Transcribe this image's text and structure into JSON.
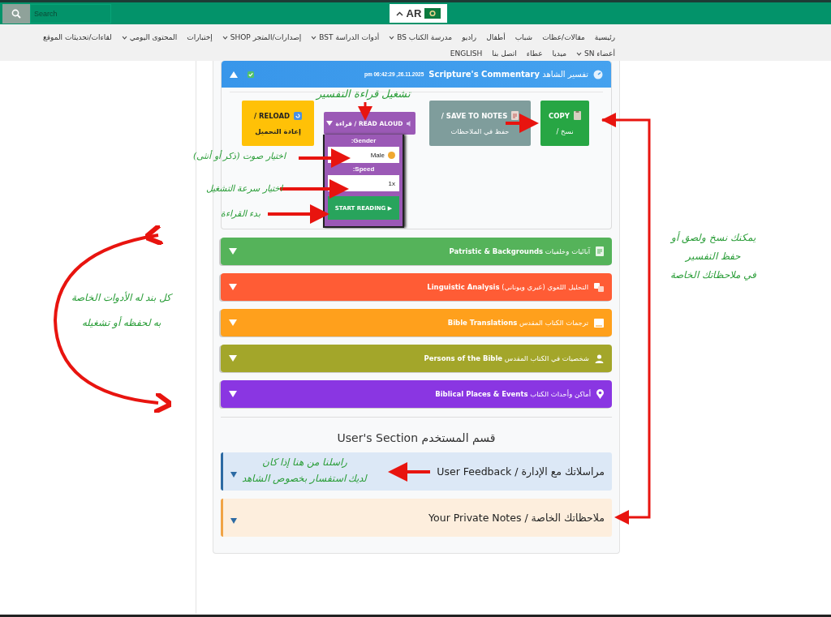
{
  "search": {
    "placeholder": "Search"
  },
  "language": {
    "code": "AR",
    "expanded": true
  },
  "nav": {
    "rows": [
      [
        {
          "label": "رئيسية",
          "dropdown": false
        },
        {
          "label": "مقالات/عظات",
          "dropdown": false
        },
        {
          "label": "شباب",
          "dropdown": false
        },
        {
          "label": "أطفال",
          "dropdown": false
        },
        {
          "label": "راديو",
          "dropdown": false
        },
        {
          "label": "مدرسة الكتاب BS",
          "dropdown": true
        },
        {
          "label": "أدوات الدراسة BST",
          "dropdown": true
        },
        {
          "label": "إصدارات/المتجر SHOP",
          "dropdown": true
        },
        {
          "label": "إختبارات",
          "dropdown": false
        },
        {
          "label": "المحتوى اليومي",
          "dropdown": true
        },
        {
          "label": "لقاءات/تحديثات الموقع",
          "dropdown": false
        }
      ],
      [
        {
          "label": "أعضاء SN",
          "dropdown": true
        },
        {
          "label": "ميديا",
          "dropdown": false
        },
        {
          "label": "عطاء",
          "dropdown": false
        },
        {
          "label": "اتصل بنا",
          "dropdown": false
        },
        {
          "label": "ENGLISH",
          "dropdown": false
        }
      ]
    ]
  },
  "commentary": {
    "title": "تفسير الشاهد **Scripture's Commentary**",
    "timestamp": "pm 06:42:29 ,26.11.2025",
    "expanded": true,
    "buttons": [
      {
        "kind": "copy",
        "label": "COPY",
        "sub": "/ نسخ"
      },
      {
        "kind": "save",
        "label": "/ SAVE TO NOTES",
        "sub": "حفظ في الملاحظات"
      },
      {
        "kind": "read",
        "label": "قراءة / READ ALOUD",
        "expanded": true
      },
      {
        "kind": "reload",
        "label": "/ RELOAD",
        "sub": "إعادة التحميل"
      }
    ],
    "reader": {
      "gender_label": ":Gender",
      "gender": "Male",
      "speed_label": ":Speed",
      "speed": "1x",
      "start": "START READING ▶"
    }
  },
  "sections": [
    {
      "kind": "document",
      "label": "آبائيات وخلفيات **Patristic & Backgrounds**",
      "color": "#55b35a",
      "expanded": false
    },
    {
      "kind": "translate",
      "label": "التحليل اللغوي (عبري ويوناني) **Linguistic Analysis**",
      "color": "#ff5c35",
      "expanded": false
    },
    {
      "kind": "book",
      "label": "ترجمات الكتاب المقدس **Bible Translations**",
      "color": "#ffa01c",
      "expanded": false
    },
    {
      "kind": "person",
      "label": "شخصيات في الكتاب المقدس **Persons of the Bible**",
      "color": "#a3a62a",
      "expanded": false
    },
    {
      "kind": "pin",
      "label": "أماكن وأحداث الكتاب **Biblical Places & Events**",
      "color": "#8a36e2",
      "expanded": false
    }
  ],
  "user_section": {
    "heading": "User's Section قسم المستخدم",
    "panels": [
      {
        "label": "User Feedback / مراسلاتك مع الإدارة",
        "color": "#2c6aa3",
        "expanded": false
      },
      {
        "label": "Your Private Notes / ملاحظاتك الخاصة",
        "color": "#f0a345",
        "expanded": false
      }
    ]
  },
  "annotations": [
    {
      "lines": [
        "تشغيل قراءة التفسير"
      ]
    },
    {
      "lines": [
        "اختيار صوت (ذكر أو أنثى)"
      ]
    },
    {
      "lines": [
        "اختيار سرعة التشغيل"
      ]
    },
    {
      "lines": [
        "بدء القراءة"
      ]
    },
    {
      "lines": [
        "يمكنك نسخ ولصق أو",
        "حفظ التفسير",
        "في ملاحظاتك الخاصة"
      ]
    },
    {
      "lines": [
        "كل بند له الأدوات الخاصة",
        "به لحفظه أو تشغيله"
      ]
    },
    {
      "lines": [
        "راسلنا من هنا إذا كان",
        "لديك استفسار بخصوص الشاهد"
      ]
    }
  ]
}
